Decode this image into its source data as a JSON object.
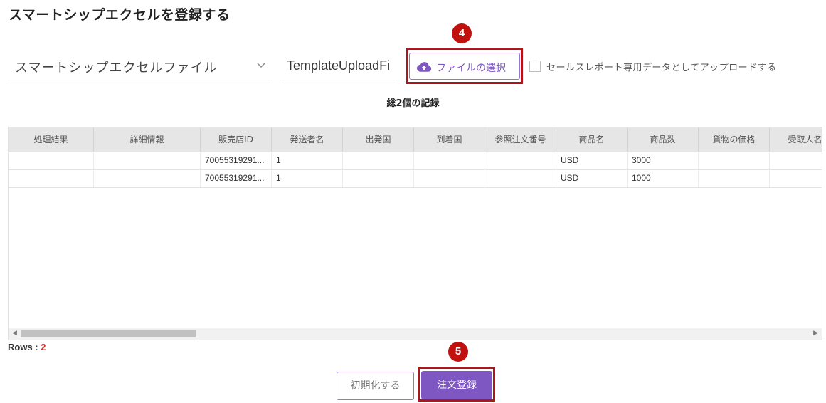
{
  "page_title": "スマートシップエクセルを登録する",
  "file_type_select": {
    "value": "スマートシップエクセルファイル"
  },
  "file_input": {
    "value": "TemplateUploadFi"
  },
  "select_file_button": {
    "label": "ファイルの選択"
  },
  "sales_report_checkbox": {
    "label": "セールスレポート専用データとしてアップロードする",
    "checked": false
  },
  "record_count": "総2個の記録",
  "table": {
    "columns": [
      "処理結果",
      "詳細情報",
      "販売店ID",
      "発送者名",
      "出発国",
      "到着国",
      "参照注文番号",
      "商品名",
      "商品数",
      "貨物の価格",
      "受取人名"
    ],
    "rows": [
      [
        "",
        "",
        "70055319291...",
        "1",
        "",
        "",
        "",
        "USD",
        "3000",
        "",
        ""
      ],
      [
        "",
        "",
        "70055319291...",
        "1",
        "",
        "",
        "",
        "USD",
        "1000",
        "",
        ""
      ]
    ]
  },
  "rows_label": "Rows : ",
  "rows_count": "2",
  "reset_button": {
    "label": "初期化する"
  },
  "submit_button": {
    "label": "注文登録"
  },
  "step_badges": [
    "4",
    "5"
  ],
  "colors": {
    "accent": "#7e57c2",
    "highlight": "#b3141b",
    "badge": "#c0110f"
  },
  "icons": {
    "upload": "cloud-upload-icon",
    "dropdown": "chevron-down-icon"
  }
}
